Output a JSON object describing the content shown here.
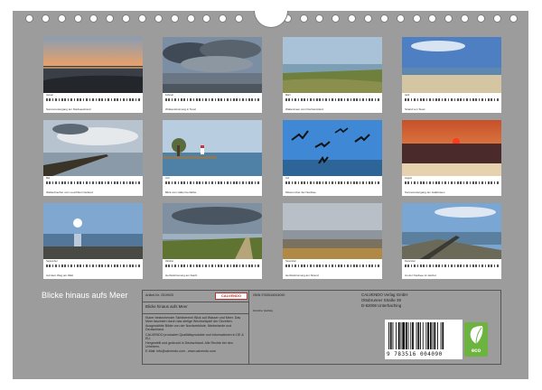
{
  "cover": {
    "title": "Blicke hinaus aufs Meer"
  },
  "months": [
    {
      "label": "Januar",
      "caption": "Sonnenuntergang am Nordseestrand",
      "theme": "sunset-beach"
    },
    {
      "label": "Februar",
      "caption": "Wolkenstimmung in Texel",
      "theme": "clouds"
    },
    {
      "label": "März",
      "caption": "Wattenmeer vom Fischerstrand",
      "theme": "wadden"
    },
    {
      "label": "April",
      "caption": "Strand von Texel",
      "theme": "beach-blue"
    },
    {
      "label": "Mai",
      "caption": "Wellenbrecher vom Leuchtturm Eckerd",
      "theme": "breakwater"
    },
    {
      "label": "Juni",
      "caption": "Blick vom Hafen bei Ebbe",
      "theme": "lighthouse"
    },
    {
      "label": "Juli",
      "caption": "Möwen über der Nordsee",
      "theme": "gulls"
    },
    {
      "label": "August",
      "caption": "Sonnenuntergang am Jadebusen",
      "theme": "red-sunset"
    },
    {
      "label": "September",
      "caption": "Auf dem Weg am Watt",
      "theme": "sun-sea"
    },
    {
      "label": "Oktober",
      "caption": "Herbststimmung am Deich",
      "theme": "dike"
    },
    {
      "label": "November",
      "caption": "Herbststimmung am Strand",
      "theme": "november"
    },
    {
      "label": "Dezember",
      "caption": "An der Nordsee im Herbst",
      "theme": "groyne"
    }
  ],
  "info": {
    "article": "Artikel-Nr: 2519925",
    "publisher_logo": "CALVENDO",
    "series_title": "Blicke hinaus aufs Meer",
    "description": "Klarer bestechender Sichtbereich Blick auf Wasser und Meer. Das Meer fasziniert durch das stetige Wechselspiel der Gezeiten. Ausgewählte Bilder von der Nordseeküste, Niederlande und Deutschland.",
    "legal": "CALVENDO produziert Qualitätsprodukte und Informationen in DE & EU.",
    "legal2": "Hergestellt und gedruckt in Deutschland. Alle Rechte bei den Urhebern.",
    "email": "E-Mail: info@calvendo.com - www.calvendo.com",
    "isbn": "ISBN 9783516004090",
    "author": "Hansine Hedwig",
    "address_line1": "CALVENDO Verlag GmbH",
    "address_line2": "Ottobrunner Straße 39",
    "address_line3": "D-82008 Unterhaching"
  },
  "barcode": {
    "number": "9 783516 004090"
  },
  "eco_label": "eco"
}
